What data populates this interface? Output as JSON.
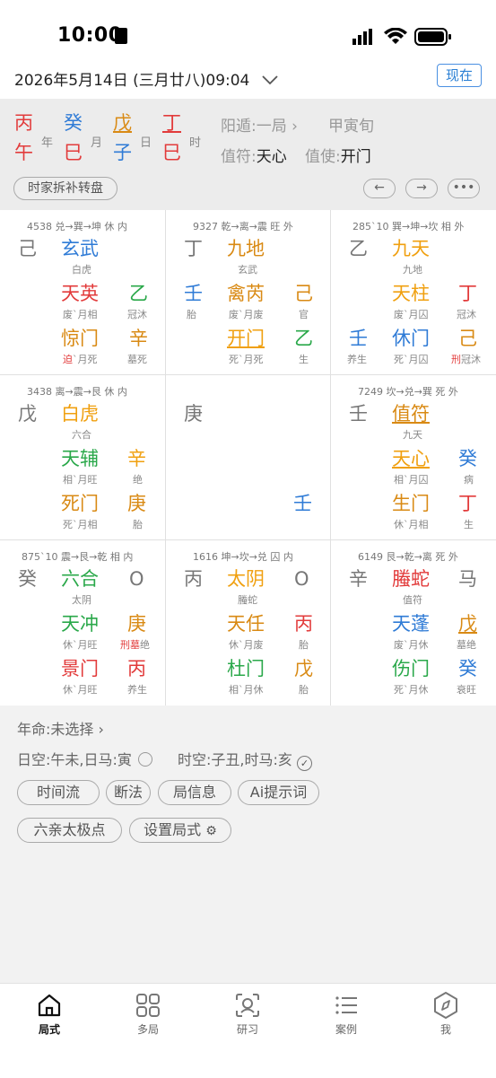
{
  "status_bar": {
    "time": "10:00"
  },
  "date_bar": {
    "date_text": "2026年5月14日 (三月廿八)09:04",
    "now_label": "现在"
  },
  "header": {
    "year": {
      "stem": "丙",
      "branch": "午",
      "label": "年"
    },
    "month": {
      "stem": "癸",
      "branch": "巳",
      "label": "月"
    },
    "day": {
      "stem": "戊",
      "branch": "子",
      "label": "日"
    },
    "hour": {
      "stem": "丁",
      "branch": "巳",
      "label": "时"
    },
    "dun": "阳遁:一局",
    "xun": "甲寅旬",
    "zhifu_label": "值符:",
    "zhifu_value": "天心",
    "zhishi_label": "值使:",
    "zhishi_value": "开门",
    "split_btn": "时家拆补转盘"
  },
  "palaces": [
    {
      "head": "4538 兑→巽→坤 休 内",
      "left": "己",
      "god": "玄武",
      "god_sub": "白虎",
      "star": "天英",
      "star_sub": "废`月相",
      "star_stem": "乙",
      "star_stem_sub": "冠沐",
      "door": "惊门",
      "door_sub_a": "迫",
      "door_sub_b": "`月死",
      "door_stem": "辛",
      "door_stem_sub": "墓死"
    },
    {
      "head": "9327 乾→离→震 旺 外",
      "left": "丁",
      "god": "九地",
      "god_sub": "玄武",
      "star": "禽芮",
      "star_sub": "废`月废",
      "star_stem": "己",
      "star_stem_sub": "官",
      "left2": "壬",
      "left2_sub": "胎",
      "door": "开门",
      "door_sub": "死`月死",
      "door_stem": "乙",
      "door_stem_sub": "生"
    },
    {
      "head": "285`10 巽→坤→坎 相 外",
      "left": "乙",
      "god": "九天",
      "god_sub": "九地",
      "star": "天柱",
      "star_sub": "废`月囚",
      "star_stem": "丁",
      "star_stem_sub": "冠沐",
      "left2": "壬",
      "left2_sub": "养生",
      "door": "休门",
      "door_sub": "死`月囚",
      "door_stem": "己",
      "door_stem_sub_a": "刑",
      "door_stem_sub_b": "冠沐"
    },
    {
      "head": "3438 离→震→艮 休 内",
      "left": "戊",
      "god": "白虎",
      "god_sub": "六合",
      "star": "天辅",
      "star_sub": "相`月旺",
      "star_stem": "辛",
      "star_stem_sub": "绝",
      "door": "死门",
      "door_sub": "死`月相",
      "door_stem": "庚",
      "door_stem_sub": "胎"
    },
    {
      "left": "庚",
      "corner": "壬"
    },
    {
      "head": "7249 坎→兑→巽 死 外",
      "left": "壬",
      "god": "值符",
      "god_sub": "九天",
      "star": "天心",
      "star_sub": "相`月囚",
      "star_stem": "癸",
      "star_stem_sub": "病",
      "door": "生门",
      "door_sub": "休`月相",
      "door_stem": "丁",
      "door_stem_sub": "生"
    },
    {
      "head": "875`10 震→艮→乾 相 内",
      "left": "癸",
      "god": "六合",
      "god_sub": "太阴",
      "god_right": "O",
      "star": "天冲",
      "star_sub": "休`月旺",
      "star_stem": "庚",
      "star_stem_sub_a": "刑墓",
      "star_stem_sub_b": "绝",
      "door": "景门",
      "door_sub": "休`月旺",
      "door_stem": "丙",
      "door_stem_sub": "养生"
    },
    {
      "head": "1616 坤→坎→兑 囚 内",
      "left": "丙",
      "god": "太阴",
      "god_sub": "螣蛇",
      "god_right": "O",
      "star": "天任",
      "star_sub": "休`月废",
      "star_stem": "丙",
      "star_stem_sub": "胎",
      "door": "杜门",
      "door_sub": "相`月休",
      "door_stem": "戊",
      "door_stem_sub": "胎"
    },
    {
      "head": "6149 艮→乾→离 死 外",
      "left": "辛",
      "god": "螣蛇",
      "god_sub": "值符",
      "god_right": "马",
      "star": "天蓬",
      "star_sub": "废`月休",
      "star_stem": "戊",
      "star_stem_sub": "墓绝",
      "door": "伤门",
      "door_sub": "死`月休",
      "door_stem": "癸",
      "door_stem_sub": "衰旺"
    }
  ],
  "info": {
    "nianming": "年命:未选择",
    "rikong": "日空:午未,日马:寅",
    "shikong": "时空:子丑,时马:亥"
  },
  "buttons": [
    "时间流",
    "断法",
    "局信息",
    "Ai提示词",
    "六亲太极点",
    "设置局式"
  ],
  "tabs": [
    "局式",
    "多局",
    "研习",
    "案例",
    "我"
  ]
}
